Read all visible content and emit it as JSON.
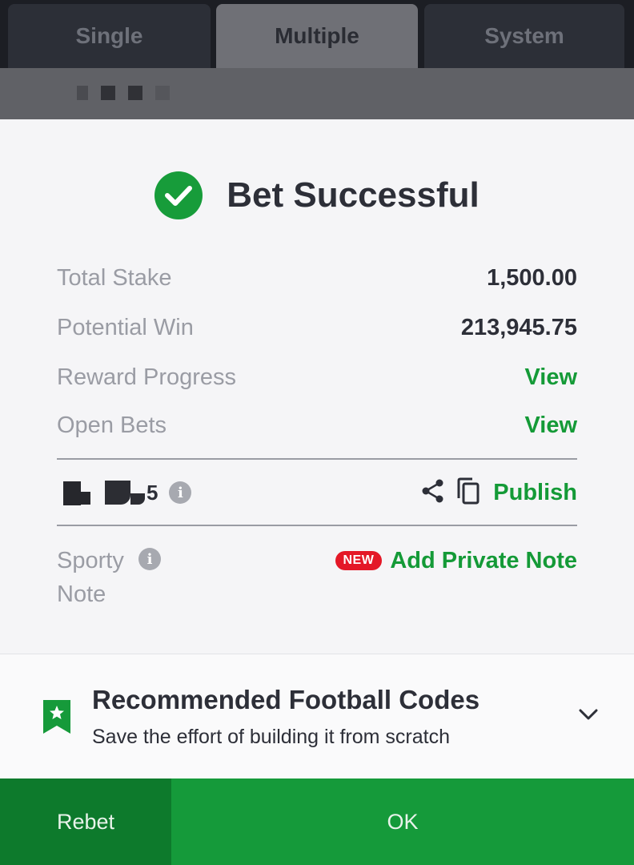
{
  "tabs": [
    {
      "label": "Single"
    },
    {
      "label": "Multiple",
      "active": true
    },
    {
      "label": "System"
    }
  ],
  "modal": {
    "title": "Bet Successful",
    "rows": [
      {
        "label": "Total Stake",
        "value": "1,500.00"
      },
      {
        "label": "Potential Win",
        "value": "213,945.75"
      },
      {
        "label": "Reward Progress",
        "link": "View"
      },
      {
        "label": "Open Bets",
        "link": "View"
      }
    ],
    "booking_code": {
      "visible_suffix": "5",
      "publish_label": "Publish"
    },
    "sporty_note": {
      "label": "Sporty Note",
      "badge": "NEW",
      "action": "Add Private Note"
    }
  },
  "recommended": {
    "title": "Recommended Football Codes",
    "subtitle": "Save the effort of building it from scratch"
  },
  "buttons": {
    "rebet": "Rebet",
    "ok": "OK"
  },
  "colors": {
    "brand_green": "#149a37",
    "badge_red": "#e41827",
    "dark_text": "#2d2f38",
    "muted_text": "#9a9ca4"
  }
}
